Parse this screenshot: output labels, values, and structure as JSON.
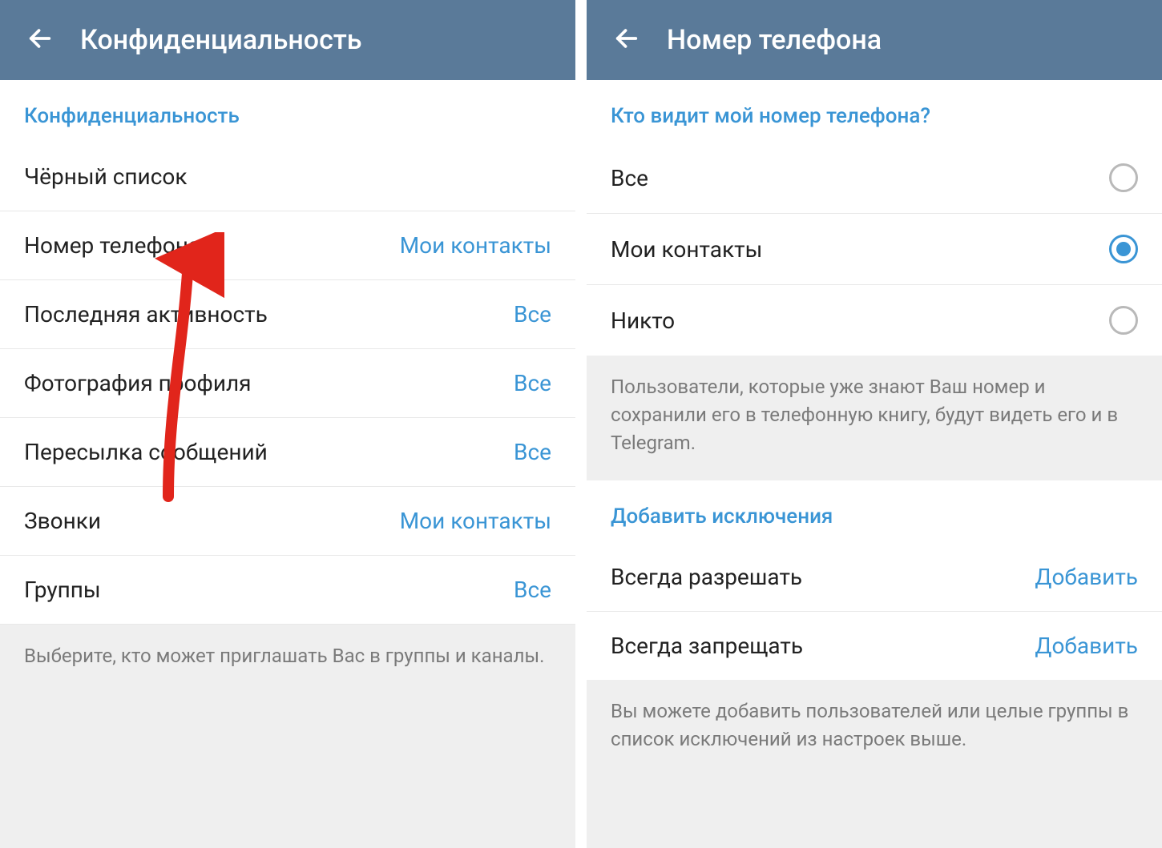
{
  "left": {
    "title": "Конфиденциальность",
    "section_header": "Конфиденциальность",
    "rows": [
      {
        "label": "Чёрный список",
        "value": ""
      },
      {
        "label": "Номер телефона",
        "value": "Мои контакты"
      },
      {
        "label": "Последняя активность",
        "value": "Все"
      },
      {
        "label": "Фотография профиля",
        "value": "Все"
      },
      {
        "label": "Пересылка сообщений",
        "value": "Все"
      },
      {
        "label": "Звонки",
        "value": "Мои контакты"
      },
      {
        "label": "Группы",
        "value": "Все"
      }
    ],
    "footer": "Выберите, кто может приглашать Вас в группы и каналы."
  },
  "right": {
    "title": "Номер телефона",
    "section_header": "Кто видит мой номер телефона?",
    "options": [
      {
        "label": "Все",
        "selected": false
      },
      {
        "label": "Мои контакты",
        "selected": true
      },
      {
        "label": "Никто",
        "selected": false
      }
    ],
    "info1": "Пользователи, которые уже знают Ваш номер и сохранили его в телефонную книгу, будут видеть его и в Telegram.",
    "exceptions_header": "Добавить исключения",
    "exceptions": [
      {
        "label": "Всегда разрешать",
        "action": "Добавить"
      },
      {
        "label": "Всегда запрещать",
        "action": "Добавить"
      }
    ],
    "info2": "Вы можете добавить пользователей или целые группы в список исключений из настроек выше."
  }
}
